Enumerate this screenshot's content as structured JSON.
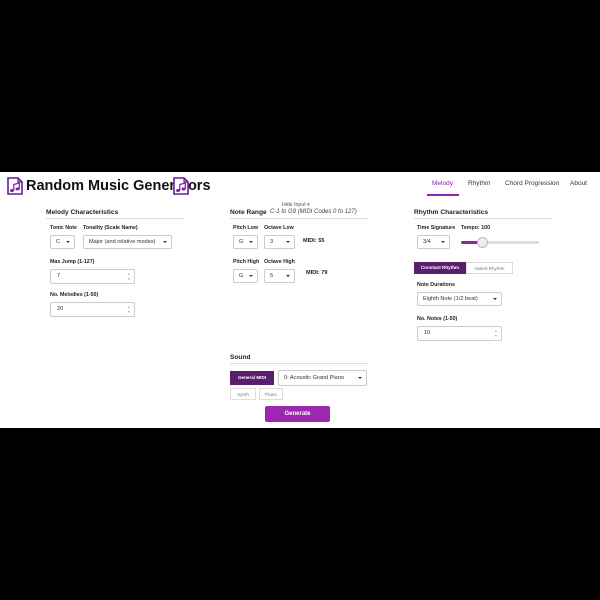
{
  "header": {
    "title": "Random Music Generators",
    "nav": [
      "Melody",
      "Rhythm",
      "Chord Progression",
      "About"
    ],
    "active_nav": "Melody",
    "accent_color": "#8e24aa",
    "icon": "music-file-icon"
  },
  "hide_input": "Hide Input ▾",
  "melody": {
    "title": "Melody Characteristics",
    "tonic_label": "Tonic Note",
    "tonic_value": "C",
    "tonality_label": "Tonality (Scale Name)",
    "tonality_value": "Major (and relative modes)",
    "max_jump_label": "Max Jump (1-127)",
    "max_jump_value": "7",
    "num_melodies_label": "No. Melodies (1-50)",
    "num_melodies_value": "20"
  },
  "note_range": {
    "title": "Note Range",
    "note": "C-1 to G9 (MIDI Codes 0 to 127)",
    "pitch_low_label": "Pitch Low",
    "pitch_low_value": "G",
    "octave_low_label": "Octave Low",
    "octave_low_value": "3",
    "midi_low": "MIDI: 55",
    "pitch_high_label": "Pitch High",
    "pitch_high_value": "G",
    "octave_high_label": "Octave High",
    "octave_high_value": "5",
    "midi_high": "MIDI: 79"
  },
  "rhythm": {
    "title": "Rhythm Characteristics",
    "time_sig_label": "Time Signature",
    "time_sig_value": "3/4",
    "tempo_label": "Tempo: 100",
    "tempo_value": 100,
    "constant_label": "Constant Rhythm",
    "varied_label": "Varied Rhythm",
    "note_durations_label": "Note Durations",
    "note_durations_value": "Eighth Note (1/2 beat)",
    "num_notes_label": "No. Notes (1-50)",
    "num_notes_value": "10"
  },
  "sound": {
    "title": "Sound",
    "general_midi_label": "General MIDI",
    "instrument_value": "0: Acoustic Grand Piano",
    "synth_label": "Synth",
    "piano_label": "Piano"
  },
  "generate_label": "Generate"
}
